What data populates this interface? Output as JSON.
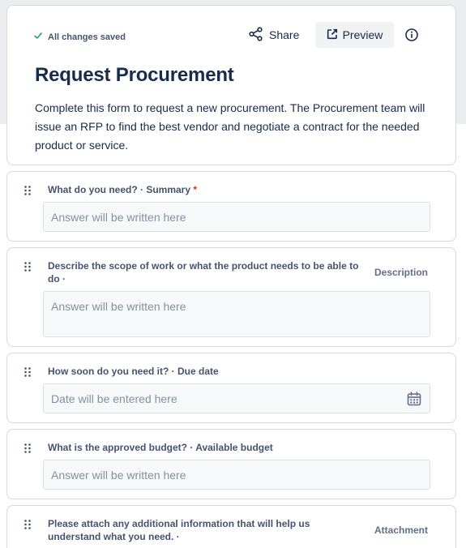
{
  "header": {
    "saved_status": "All changes saved",
    "share_label": "Share",
    "preview_label": "Preview",
    "title": "Request Procurement",
    "description": "Complete this form to request a new procurement. The Procurement team will issue an RFP to find the best vendor and negotiate a contract for the needed product or service."
  },
  "questions": [
    {
      "label": "What do you need? · Summary",
      "required_mark": "*",
      "placeholder": "Answer will be written here"
    },
    {
      "label": "Describe the scope of work or what the product needs to be able to do ·",
      "type": "Description",
      "placeholder": "Answer will be written here"
    },
    {
      "label": "How soon do you need it? · Due date",
      "placeholder": "Date will be entered here"
    },
    {
      "label": "What is the approved budget? · Available budget",
      "placeholder": "Answer will be written here"
    },
    {
      "label": "Please attach any additional information that will help us understand what you need. ·",
      "type": "Attachment"
    }
  ],
  "icons": {
    "saved": "check-icon",
    "share": "share-icon",
    "preview": "external-link-icon",
    "info": "info-icon",
    "drag": "drag-handle-icon",
    "date": "calendar-icon"
  },
  "colors": {
    "text": "#172b4d",
    "subtle_text": "#44546f",
    "placeholder": "#8590a2",
    "required": "#de350b",
    "saved_check": "#22a06b",
    "top_background": "#ebecf0"
  }
}
